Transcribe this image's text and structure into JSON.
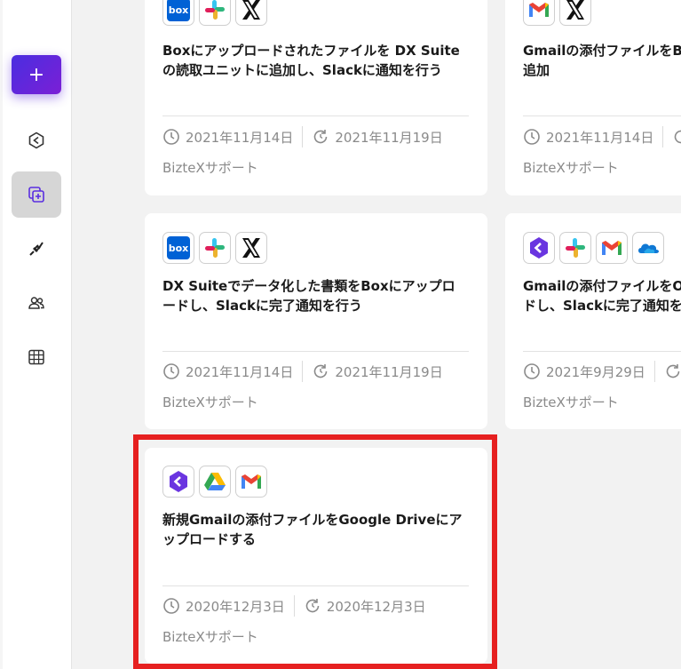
{
  "sidebar": {
    "add_label": "+",
    "nav": [
      {
        "icon": "flow-icon"
      },
      {
        "icon": "template-icon",
        "active": true
      },
      {
        "icon": "plug-icon"
      },
      {
        "icon": "users-icon"
      },
      {
        "icon": "table-icon"
      }
    ]
  },
  "cards": [
    {
      "title": "Boxにアップロードされたファイルを DX Suite\nの読取ユニットに追加し、Slackに通知を行う",
      "icons": [
        "box-icon",
        "slack-icon",
        "x-icon"
      ],
      "created": "2021年11月14日",
      "updated": "2021年11月19日",
      "author": "BizteXサポート"
    },
    {
      "title": "Gmailの添付ファイルをB\n追加",
      "icons": [
        "gmail-icon",
        "x-icon"
      ],
      "created": "2021年11月14日",
      "updated": "",
      "author": "BizteXサポート"
    },
    {
      "title": "DX Suiteでデータ化した書類をBoxにアップロ\nードし、Slackに完了通知を行う",
      "icons": [
        "box-icon",
        "slack-icon",
        "x-icon"
      ],
      "created": "2021年11月14日",
      "updated": "2021年11月19日",
      "author": "BizteXサポート"
    },
    {
      "title": "Gmailの添付ファイルをO\nドし、Slackに完了通知を",
      "icons": [
        "biztex-icon",
        "slack-icon",
        "gmail-icon",
        "onedrive-icon"
      ],
      "created": "2021年9月29日",
      "updated": "",
      "author": "BizteXサポート"
    },
    {
      "title": "新規Gmailの添付ファイルをGoogle Driveにア\nップロードする",
      "icons": [
        "biztex-icon",
        "gdrive-icon",
        "gmail-icon"
      ],
      "created": "2020年12月3日",
      "updated": "2020年12月3日",
      "author": "BizteXサポート"
    }
  ],
  "colors": {
    "accent": "#5a2ee0",
    "highlight": "#e62020",
    "box": "#0061d5"
  }
}
